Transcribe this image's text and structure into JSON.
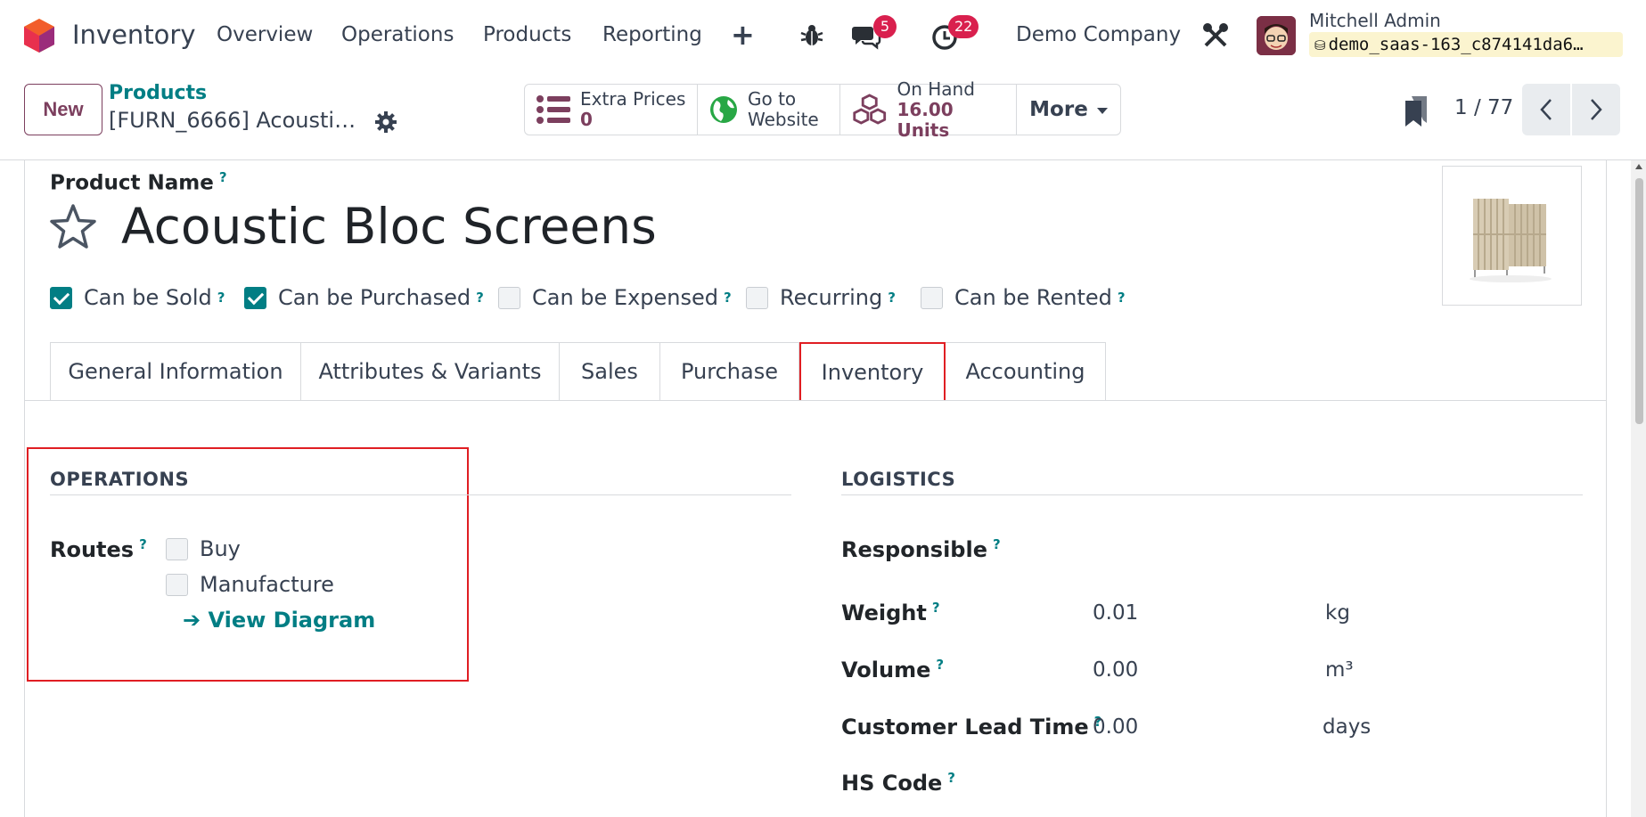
{
  "navbar": {
    "app_title": "Inventory",
    "menu": [
      "Overview",
      "Operations",
      "Products",
      "Reporting"
    ],
    "plus": "+",
    "messages_count": "5",
    "activities_count": "22",
    "company": "Demo Company",
    "user_name": "Mitchell Admin",
    "db_name": "demo_saas-163_c874141da6…"
  },
  "control": {
    "new_label": "New",
    "breadcrumb_parent": "Products",
    "breadcrumb_current": "[FURN_6666] Acoustic …",
    "smart_buttons": {
      "extra_prices_label": "Extra Prices",
      "extra_prices_value": "0",
      "website_line1": "Go to",
      "website_line2": "Website",
      "on_hand_label": "On Hand",
      "on_hand_value": "16.00 Units",
      "more_label": "More"
    },
    "pager": "1 / 77"
  },
  "form": {
    "product_name_label": "Product Name",
    "help_mark": "?",
    "product_name": "Acoustic Bloc Screens",
    "options": [
      {
        "label": "Can be Sold",
        "checked": true
      },
      {
        "label": "Can be Purchased",
        "checked": true
      },
      {
        "label": "Can be Expensed",
        "checked": false
      },
      {
        "label": "Recurring",
        "checked": false
      },
      {
        "label": "Can be Rented",
        "checked": false
      }
    ],
    "tabs": [
      "General Information",
      "Attributes & Variants",
      "Sales",
      "Purchase",
      "Inventory",
      "Accounting"
    ],
    "active_tab": "Inventory",
    "operations": {
      "title": "OPERATIONS",
      "routes_label": "Routes",
      "routes": [
        {
          "label": "Buy",
          "checked": false
        },
        {
          "label": "Manufacture",
          "checked": false
        }
      ],
      "view_diagram": "➔ View Diagram"
    },
    "logistics": {
      "title": "LOGISTICS",
      "responsible_label": "Responsible",
      "weight_label": "Weight",
      "weight_value": "0.01",
      "weight_unit": "kg",
      "volume_label": "Volume",
      "volume_value": "0.00",
      "volume_unit": "m³",
      "lead_time_label": "Customer Lead Time",
      "lead_time_value": "0.00",
      "lead_time_unit": "days",
      "hs_code_label": "HS Code"
    }
  },
  "colors": {
    "brand": "#7c3f5e",
    "link": "#017e84",
    "highlight": "#e01e23",
    "badge": "#d9204e"
  }
}
